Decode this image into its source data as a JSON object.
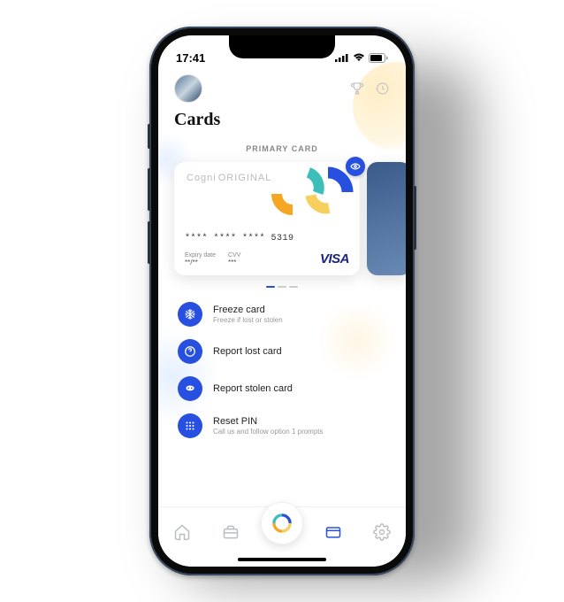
{
  "status_bar": {
    "time": "17:41"
  },
  "header": {
    "title": "Cards",
    "section_label": "PRIMARY CARD"
  },
  "card": {
    "brand": "Cogni",
    "variant": "ORIGINAL",
    "number_masked": "**** **** **** 5319",
    "expiry_label": "Expiry date",
    "expiry_value": "**/**",
    "cvv_label": "CVV",
    "cvv_value": "***",
    "network": "VISA"
  },
  "actions": [
    {
      "title": "Freeze card",
      "sub": "Freeze if lost or stolen",
      "icon": "snowflake-icon"
    },
    {
      "title": "Report lost card",
      "sub": "",
      "icon": "question-icon"
    },
    {
      "title": "Report stolen card",
      "sub": "",
      "icon": "mask-icon"
    },
    {
      "title": "Reset PIN",
      "sub": "Call us and follow option 1 prompts",
      "icon": "keypad-icon"
    }
  ],
  "tabs": [
    "home",
    "wallet",
    "logo",
    "cards",
    "settings"
  ],
  "colors": {
    "accent": "#2850e0",
    "accent2": "#f5a623",
    "accent3": "#3cbfb8",
    "yellow": "#f7cf5c"
  }
}
